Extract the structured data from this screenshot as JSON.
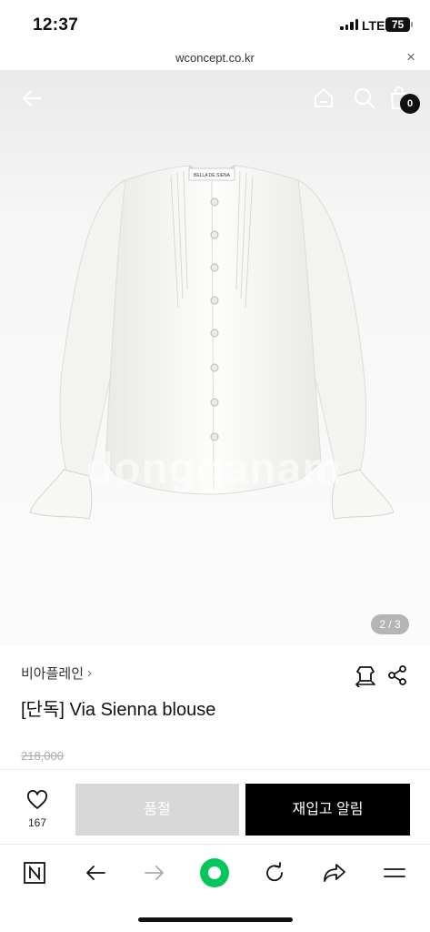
{
  "status": {
    "time": "12:37",
    "network": "LTE",
    "battery": "75"
  },
  "browser": {
    "url": "wconcept.co.kr",
    "close_icon": "×"
  },
  "hero": {
    "cart_count": "0",
    "image_page": "2 / 3",
    "watermark": "dongganam",
    "label_text": "BELLA DE SIENA"
  },
  "product": {
    "brand": "비아플레인",
    "brand_chevron": "›",
    "title": "[단독] Via Sienna blouse",
    "original_price": "218,000"
  },
  "actions": {
    "like_count": "167",
    "soldout_label": "품절",
    "restock_label": "재입고 알림"
  },
  "toolbar": {
    "icons": [
      "naver-n-icon",
      "back-arrow-icon",
      "forward-arrow-icon",
      "green-dot-home-icon",
      "refresh-icon",
      "share-arrow-icon",
      "menu-icon"
    ]
  },
  "colors": {
    "accent_green": "#03c75a",
    "soldout_gray": "#d8d8d8",
    "cta_black": "#000000"
  }
}
